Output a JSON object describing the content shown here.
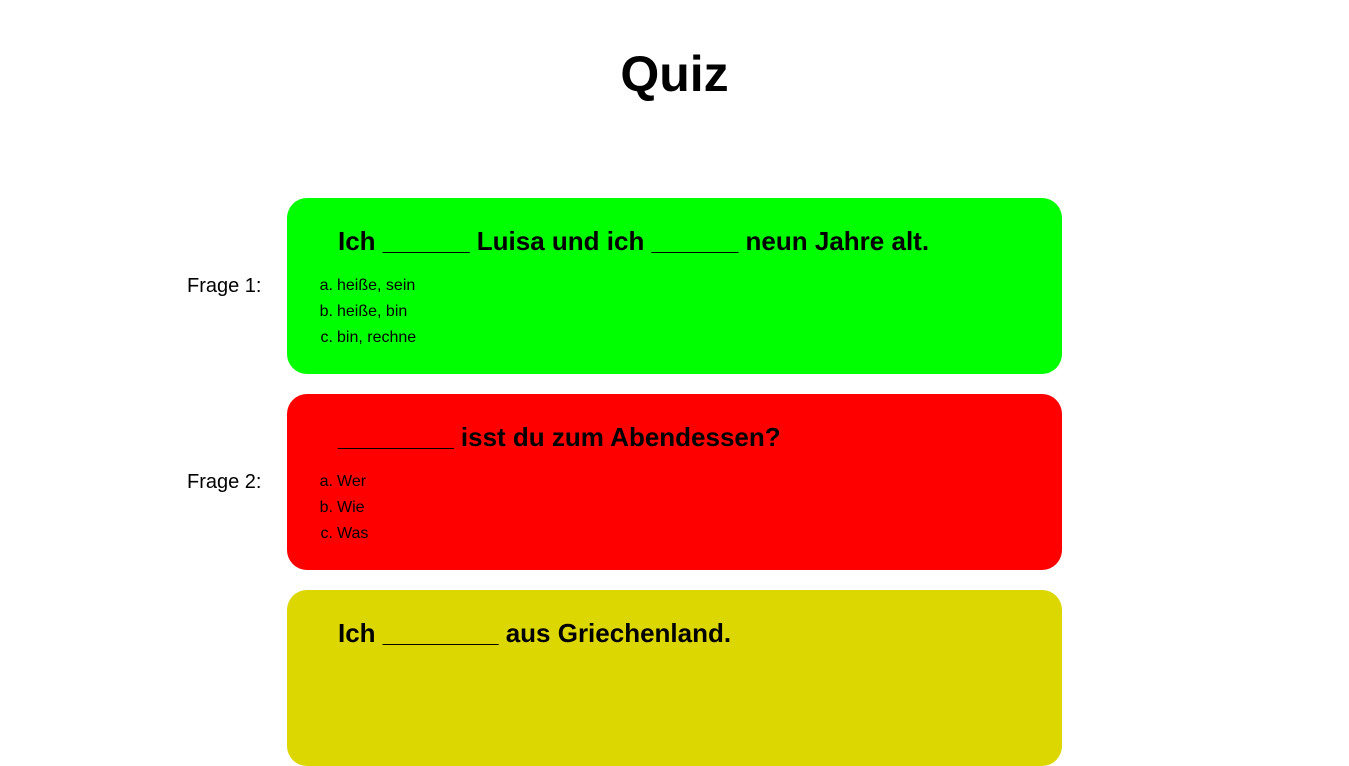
{
  "page": {
    "title": "Quiz"
  },
  "questions": [
    {
      "label": "Frage 1:",
      "text": "Ich ______ Luisa und ich ______ neun Jahre alt.",
      "color": "#00ff00",
      "options": [
        {
          "letter": "a.",
          "text": "heiße, sein"
        },
        {
          "letter": "b.",
          "text": "heiße, bin"
        },
        {
          "letter": "c.",
          "text": "bin, rechne"
        }
      ]
    },
    {
      "label": "Frage 2:",
      "text": "________ isst du zum Abendessen?",
      "color": "#ff0000",
      "options": [
        {
          "letter": "a.",
          "text": "Wer"
        },
        {
          "letter": "b.",
          "text": "Wie"
        },
        {
          "letter": "c.",
          "text": "Was"
        }
      ]
    },
    {
      "label": "",
      "text": "Ich ________ aus Griechenland.",
      "color": "#dcd700",
      "options": []
    }
  ]
}
